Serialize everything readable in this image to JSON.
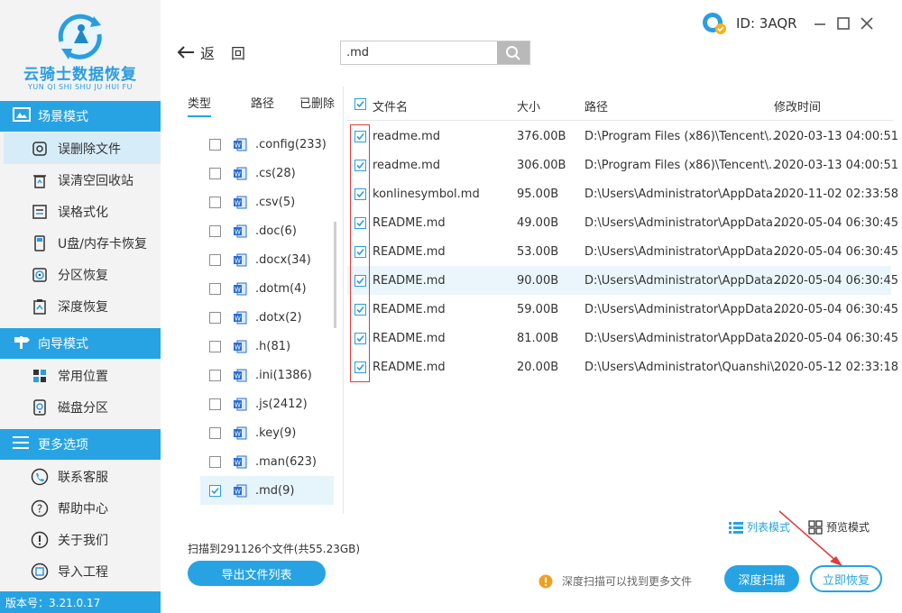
{
  "brand": {
    "title": "云骑士数据恢复",
    "subtitle": "YUN QI SHI SHU JU HUI FU"
  },
  "sidebar": {
    "sections": [
      {
        "label": "场景模式",
        "icon": "scene-icon"
      },
      {
        "label": "向导模式",
        "icon": "guide-icon"
      },
      {
        "label": "更多选项",
        "icon": "menu-icon"
      }
    ],
    "scene_items": [
      {
        "label": "误删除文件",
        "icon": "deleted-file-icon",
        "active": true
      },
      {
        "label": "误清空回收站",
        "icon": "recycle-bin-icon"
      },
      {
        "label": "误格式化",
        "icon": "format-icon"
      },
      {
        "label": "U盘/内存卡恢复",
        "icon": "usb-drive-icon"
      },
      {
        "label": "分区恢复",
        "icon": "partition-icon"
      },
      {
        "label": "深度恢复",
        "icon": "deep-recover-icon"
      }
    ],
    "guide_items": [
      {
        "label": "常用位置",
        "icon": "common-location-icon"
      },
      {
        "label": "磁盘分区",
        "icon": "disk-partition-icon"
      }
    ],
    "more_items": [
      {
        "label": "联系客服",
        "icon": "customer-service-icon"
      },
      {
        "label": "帮助中心",
        "icon": "help-icon"
      },
      {
        "label": "关于我们",
        "icon": "info-icon"
      },
      {
        "label": "导入工程",
        "icon": "import-icon"
      }
    ],
    "version": "版本号：3.21.0.17"
  },
  "topbar": {
    "back_label": "返回",
    "search_value": ".md",
    "user_id": "ID: 3AQR"
  },
  "type_panel": {
    "tabs": [
      "类型",
      "路径",
      "已删除"
    ],
    "items": [
      {
        "label": ".config(233)",
        "checked": false
      },
      {
        "label": ".cs(28)",
        "checked": false
      },
      {
        "label": ".csv(5)",
        "checked": false
      },
      {
        "label": ".doc(6)",
        "checked": false
      },
      {
        "label": ".docx(34)",
        "checked": false
      },
      {
        "label": ".dotm(4)",
        "checked": false
      },
      {
        "label": ".dotx(2)",
        "checked": false
      },
      {
        "label": ".h(81)",
        "checked": false
      },
      {
        "label": ".ini(1386)",
        "checked": false
      },
      {
        "label": ".js(2412)",
        "checked": false
      },
      {
        "label": ".key(9)",
        "checked": false
      },
      {
        "label": ".man(623)",
        "checked": false
      },
      {
        "label": ".md(9)",
        "checked": true
      }
    ]
  },
  "file_table": {
    "columns": {
      "name": "文件名",
      "size": "大小",
      "path": "路径",
      "modified": "修改时间"
    },
    "rows": [
      {
        "name": "readme.md",
        "size": "376.00B",
        "path": "D:\\Program Files (x86)\\Tencent\\...",
        "modified": "2020-03-13 04:00:51"
      },
      {
        "name": "readme.md",
        "size": "306.00B",
        "path": "D:\\Program Files (x86)\\Tencent\\...",
        "modified": "2020-03-13 04:00:51"
      },
      {
        "name": "konlinesymbol.md",
        "size": "95.00B",
        "path": "D:\\Users\\Administrator\\AppData...",
        "modified": "2020-11-02 02:33:58"
      },
      {
        "name": "README.md",
        "size": "49.00B",
        "path": "D:\\Users\\Administrator\\AppData...",
        "modified": "2020-05-04 06:30:45"
      },
      {
        "name": "README.md",
        "size": "53.00B",
        "path": "D:\\Users\\Administrator\\AppData...",
        "modified": "2020-05-04 06:30:45"
      },
      {
        "name": "README.md",
        "size": "90.00B",
        "path": "D:\\Users\\Administrator\\AppData...",
        "modified": "2020-05-04 06:30:45"
      },
      {
        "name": "README.md",
        "size": "59.00B",
        "path": "D:\\Users\\Administrator\\AppData...",
        "modified": "2020-05-04 06:30:45"
      },
      {
        "name": "README.md",
        "size": "81.00B",
        "path": "D:\\Users\\Administrator\\AppData...",
        "modified": "2020-05-04 06:30:45"
      },
      {
        "name": "README.md",
        "size": "20.00B",
        "path": "D:\\Users\\Administrator\\Quanshi\\...",
        "modified": "2020-05-12 02:33:18"
      }
    ],
    "highlight_row": 5
  },
  "bottom": {
    "view_list": "列表模式",
    "view_preview": "预览模式",
    "scan_summary": "扫描到291126个文件(共55.23GB)",
    "export_label": "导出文件列表",
    "deep_hint": "深度扫描可以找到更多文件",
    "deep_scan_label": "深度扫描",
    "recover_label": "立即恢复"
  },
  "colors": {
    "accent": "#27a3e3",
    "highlight": "#e03c3c",
    "warning": "#f0a020"
  }
}
